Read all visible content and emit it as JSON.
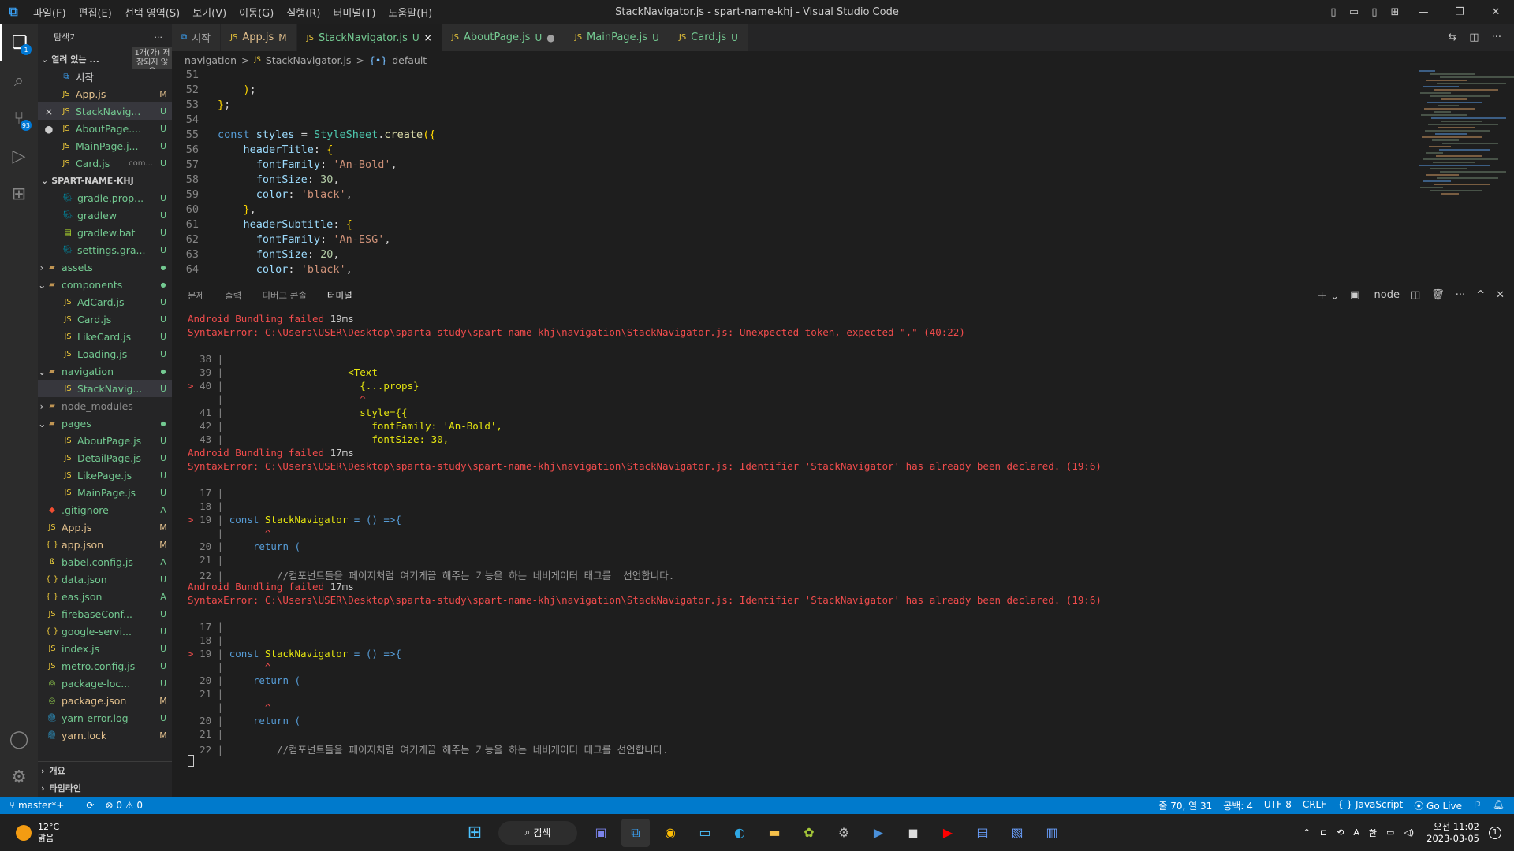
{
  "window": {
    "title": "StackNavigator.js - spart-name-khj - Visual Studio Code",
    "menu": [
      "파일(F)",
      "편집(E)",
      "선택 영역(S)",
      "보기(V)",
      "이동(G)",
      "실행(R)",
      "터미널(T)",
      "도움말(H)"
    ]
  },
  "activity": {
    "explorer_badge": "1",
    "scm_badge": "93"
  },
  "sidebar": {
    "header": "탐색기",
    "more": "···",
    "open_editors_label": "열려 있는 ...",
    "unsaved_note": "1개(가) 저장되지 않음",
    "open_editors": [
      {
        "name": "시작",
        "status": "",
        "icon": "vscode"
      },
      {
        "name": "App.js",
        "status": "M",
        "icon": "js"
      },
      {
        "name": "StackNavig...",
        "status": "U",
        "icon": "js",
        "prefix": "×"
      },
      {
        "name": "AboutPage....",
        "status": "U",
        "icon": "js",
        "prefix": "●"
      },
      {
        "name": "MainPage.j...",
        "status": "U",
        "icon": "js"
      },
      {
        "name": "Card.js",
        "sub": "com...",
        "status": "U",
        "icon": "js"
      }
    ],
    "project_label": "SPART-NAME-KHJ",
    "tree": [
      {
        "name": "gradle.prop...",
        "status": "U",
        "icon": "gradle",
        "indent": 1
      },
      {
        "name": "gradlew",
        "status": "U",
        "icon": "gradle",
        "indent": 1
      },
      {
        "name": "gradlew.bat",
        "status": "U",
        "icon": "bat",
        "indent": 1
      },
      {
        "name": "settings.gra...",
        "status": "U",
        "icon": "gradle",
        "indent": 1
      },
      {
        "name": "assets",
        "status": "●",
        "icon": "folder",
        "indent": 0,
        "chev": "›"
      },
      {
        "name": "components",
        "status": "●",
        "icon": "folder",
        "indent": 0,
        "chev": "⌄"
      },
      {
        "name": "AdCard.js",
        "status": "U",
        "icon": "js",
        "indent": 1
      },
      {
        "name": "Card.js",
        "status": "U",
        "icon": "js",
        "indent": 1
      },
      {
        "name": "LikeCard.js",
        "status": "U",
        "icon": "js",
        "indent": 1
      },
      {
        "name": "Loading.js",
        "status": "U",
        "icon": "js",
        "indent": 1
      },
      {
        "name": "navigation",
        "status": "●",
        "icon": "folder",
        "indent": 0,
        "chev": "⌄"
      },
      {
        "name": "StackNavig...",
        "status": "U",
        "icon": "js",
        "indent": 1,
        "selected": true
      },
      {
        "name": "node_modules",
        "status": "",
        "icon": "folder",
        "indent": 0,
        "chev": "›"
      },
      {
        "name": "pages",
        "status": "●",
        "icon": "folder",
        "indent": 0,
        "chev": "⌄"
      },
      {
        "name": "AboutPage.js",
        "status": "U",
        "icon": "js",
        "indent": 1
      },
      {
        "name": "DetailPage.js",
        "status": "U",
        "icon": "js",
        "indent": 1
      },
      {
        "name": "LikePage.js",
        "status": "U",
        "icon": "js",
        "indent": 1
      },
      {
        "name": "MainPage.js",
        "status": "U",
        "icon": "js",
        "indent": 1
      },
      {
        "name": ".gitignore",
        "status": "A",
        "icon": "git",
        "indent": 0
      },
      {
        "name": "App.js",
        "status": "M",
        "icon": "js",
        "indent": 0
      },
      {
        "name": "app.json",
        "status": "M",
        "icon": "json",
        "indent": 0
      },
      {
        "name": "babel.config.js",
        "status": "A",
        "icon": "babel",
        "indent": 0
      },
      {
        "name": "data.json",
        "status": "U",
        "icon": "json",
        "indent": 0
      },
      {
        "name": "eas.json",
        "status": "A",
        "icon": "json",
        "indent": 0
      },
      {
        "name": "firebaseConf...",
        "status": "U",
        "icon": "js",
        "indent": 0
      },
      {
        "name": "google-servi...",
        "status": "U",
        "icon": "json",
        "indent": 0
      },
      {
        "name": "index.js",
        "status": "U",
        "icon": "js",
        "indent": 0
      },
      {
        "name": "metro.config.js",
        "status": "U",
        "icon": "js",
        "indent": 0
      },
      {
        "name": "package-loc...",
        "status": "U",
        "icon": "npm",
        "indent": 0
      },
      {
        "name": "package.json",
        "status": "M",
        "icon": "npm",
        "indent": 0
      },
      {
        "name": "yarn-error.log",
        "status": "U",
        "icon": "yarn",
        "indent": 0
      },
      {
        "name": "yarn.lock",
        "status": "M",
        "icon": "yarn",
        "indent": 0
      }
    ],
    "outline_label": "개요",
    "timeline_label": "타임라인"
  },
  "tabs": [
    {
      "label": "시작",
      "badge": "",
      "icon": "vscode"
    },
    {
      "label": "App.js",
      "badge": "M",
      "icon": "js"
    },
    {
      "label": "StackNavigator.js",
      "badge": "U",
      "icon": "js",
      "active": true,
      "close": "×"
    },
    {
      "label": "AboutPage.js",
      "badge": "U",
      "icon": "js",
      "dot": "●"
    },
    {
      "label": "MainPage.js",
      "badge": "U",
      "icon": "js"
    },
    {
      "label": "Card.js",
      "badge": "U",
      "icon": "js"
    }
  ],
  "breadcrumb": [
    "navigation",
    ">",
    "JS",
    "StackNavigator.js",
    ">",
    "{•}",
    "default"
  ],
  "code": {
    "lines": [
      {
        "n": "51",
        "t": "        "
      },
      {
        "n": "52",
        "t": "    );"
      },
      {
        "n": "53",
        "t": "};"
      },
      {
        "n": "54",
        "t": ""
      },
      {
        "n": "55",
        "t": "const styles = StyleSheet.create({"
      },
      {
        "n": "56",
        "t": "    headerTitle: {"
      },
      {
        "n": "57",
        "t": "      fontFamily: 'An-Bold',"
      },
      {
        "n": "58",
        "t": "      fontSize: 30,"
      },
      {
        "n": "59",
        "t": "      color: 'black',"
      },
      {
        "n": "60",
        "t": "    },"
      },
      {
        "n": "61",
        "t": "    headerSubtitle: {"
      },
      {
        "n": "62",
        "t": "      fontFamily: 'An-ESG',"
      },
      {
        "n": "63",
        "t": "      fontSize: 20,"
      },
      {
        "n": "64",
        "t": "      color: 'black',"
      }
    ]
  },
  "panel": {
    "tabs": [
      "문제",
      "출력",
      "디버그 콘솔",
      "터미널"
    ],
    "active_tab": "터미널",
    "shell": "node",
    "terminal": {
      "b1_head": "Android Bundling failed",
      "b1_time": "19ms",
      "b1_err": "SyntaxError: C:\\Users\\USER\\Desktop\\sparta-study\\spart-name-khj\\navigation\\StackNavigator.js: Unexpected token, expected \",\" (40:22)",
      "b1_l38": "38",
      "b1_l39": "39",
      "b1_l39t": "<Text",
      "b1_l40": "40",
      "b1_l40t": "{...props}",
      "b1_caret": "^",
      "b1_l41": "41",
      "b1_l41t": "style={{",
      "b1_l42": "42",
      "b1_l42t": "fontFamily: 'An-Bold',",
      "b1_l43": "43",
      "b1_l43t": "fontSize: 30,",
      "b2_head": "Android Bundling failed",
      "b2_time": "17ms",
      "b2_err": "SyntaxError: C:\\Users\\USER\\Desktop\\sparta-study\\spart-name-khj\\navigation\\StackNavigator.js: Identifier 'StackNavigator' has already been declared. (19:6)",
      "l17": "17",
      "l18": "18",
      "l19": "19",
      "l19t_kw": "const",
      "l19t_name": "StackNavigator",
      "l19t_rest": "= () =>{",
      "caret": "^",
      "l20": "20",
      "l20t": "return (",
      "l21": "21",
      "l22": "22",
      "l22t": "//컴포넌트들을 페이지처럼 여기게끔 해주는 기능을 하는 네비게이터 태그를  선언합니다.",
      "b3_head": "Android Bundling failed",
      "b3_time": "17ms",
      "b3_err": "SyntaxError: C:\\Users\\USER\\Desktop\\sparta-study\\spart-name-khj\\navigation\\StackNavigator.js: Identifier 'StackNavigator' has already been declared. (19:6)",
      "b3_l22t": "//컴포넌트들을 페이지처럼 여기게끔 해주는 기능을 하는 네비게이터 태그를 선언합니다."
    }
  },
  "status": {
    "branch": "master*+",
    "sync": "⟳",
    "problems": "⊗ 0 ⚠ 0",
    "position": "줄 70, 열 31",
    "spaces": "공백: 4",
    "encoding": "UTF-8",
    "eol": "CRLF",
    "language": "{ } JavaScript",
    "golive": "⦿ Go Live"
  },
  "taskbar": {
    "temp": "12°C",
    "weather": "맑음",
    "search": "검색",
    "ime": "한",
    "lang": "A",
    "time": "오전 11:02",
    "date": "2023-03-05",
    "notif": "1"
  },
  "colors": {
    "accent": "#007acc",
    "error": "#f14c4c",
    "untracked": "#73c991",
    "modified": "#e2c08d"
  }
}
